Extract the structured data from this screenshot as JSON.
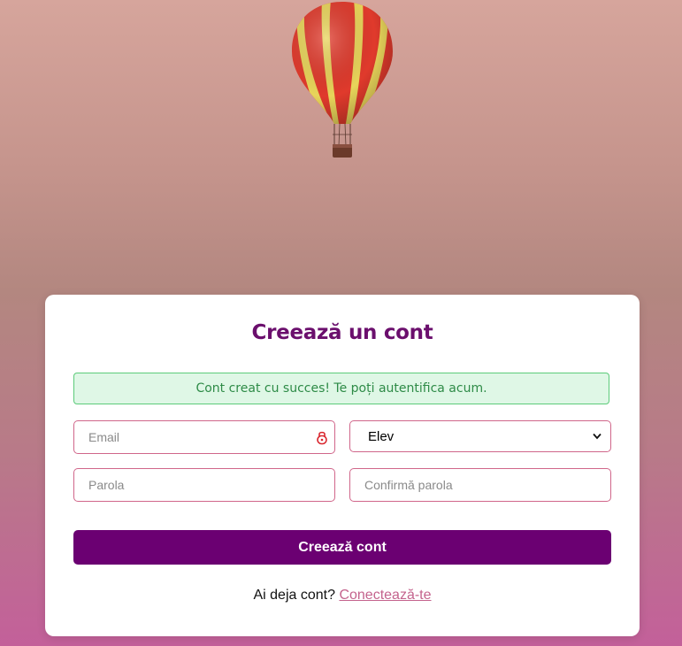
{
  "form": {
    "title": "Creează un cont",
    "success_message": "Cont creat cu succes! Te poți autentifica acum.",
    "email_placeholder": "Email",
    "password_placeholder": "Parola",
    "confirm_placeholder": "Confirmă parola",
    "role_selected": "Elev",
    "submit_label": "Creează cont"
  },
  "footer": {
    "prompt": "Ai deja cont?",
    "login_link": "Conectează-te"
  },
  "colors": {
    "title": "#6b0f6d",
    "submit_bg": "#6b0072",
    "field_border": "#d0668a",
    "success_bg": "#dff7e6",
    "success_border": "#5ccb7a",
    "success_text": "#2e8b47",
    "link": "#c4638d"
  },
  "icons": {
    "balloon": "hot-air-balloon-illustration",
    "password_manager": "lock-icon",
    "select_arrow": "chevron-down-icon"
  }
}
